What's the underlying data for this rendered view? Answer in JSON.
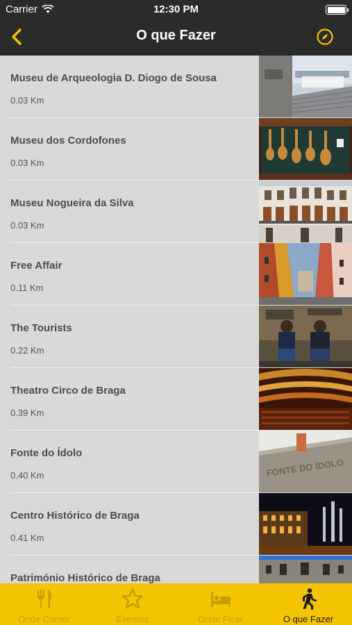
{
  "status_bar": {
    "carrier": "Carrier",
    "time": "12:30 PM"
  },
  "nav": {
    "title": "O que Fazer",
    "back_icon": "chevron-left-icon",
    "action_icon": "compass-icon"
  },
  "accent_color": "#f5c400",
  "items": [
    {
      "name": "Museu de Arqueologia D. Diogo de Sousa",
      "distance": "0.03 Km"
    },
    {
      "name": "Museu dos Cordofones",
      "distance": "0.03 Km"
    },
    {
      "name": "Museu Nogueira da Silva",
      "distance": "0.03 Km"
    },
    {
      "name": "Free Affair",
      "distance": "0.11 Km"
    },
    {
      "name": "The Tourists",
      "distance": "0.22 Km"
    },
    {
      "name": "Theatro Circo de Braga",
      "distance": "0.39 Km"
    },
    {
      "name": "Fonte do Ídolo",
      "distance": "0.40 Km"
    },
    {
      "name": "Centro Histórico de Braga",
      "distance": "0.41 Km"
    },
    {
      "name": "Património Histórico de Braga",
      "distance": ""
    }
  ],
  "thumb_texts": {
    "fonte": "FONTE DO ÍDOLO"
  },
  "tabs": [
    {
      "label": "Onde Comer",
      "icon": "fork-knife-icon"
    },
    {
      "label": "Eventos",
      "icon": "star-icon"
    },
    {
      "label": "Onde Ficar",
      "icon": "bed-icon"
    },
    {
      "label": "O que Fazer",
      "icon": "walking-person-icon",
      "active": true
    }
  ]
}
